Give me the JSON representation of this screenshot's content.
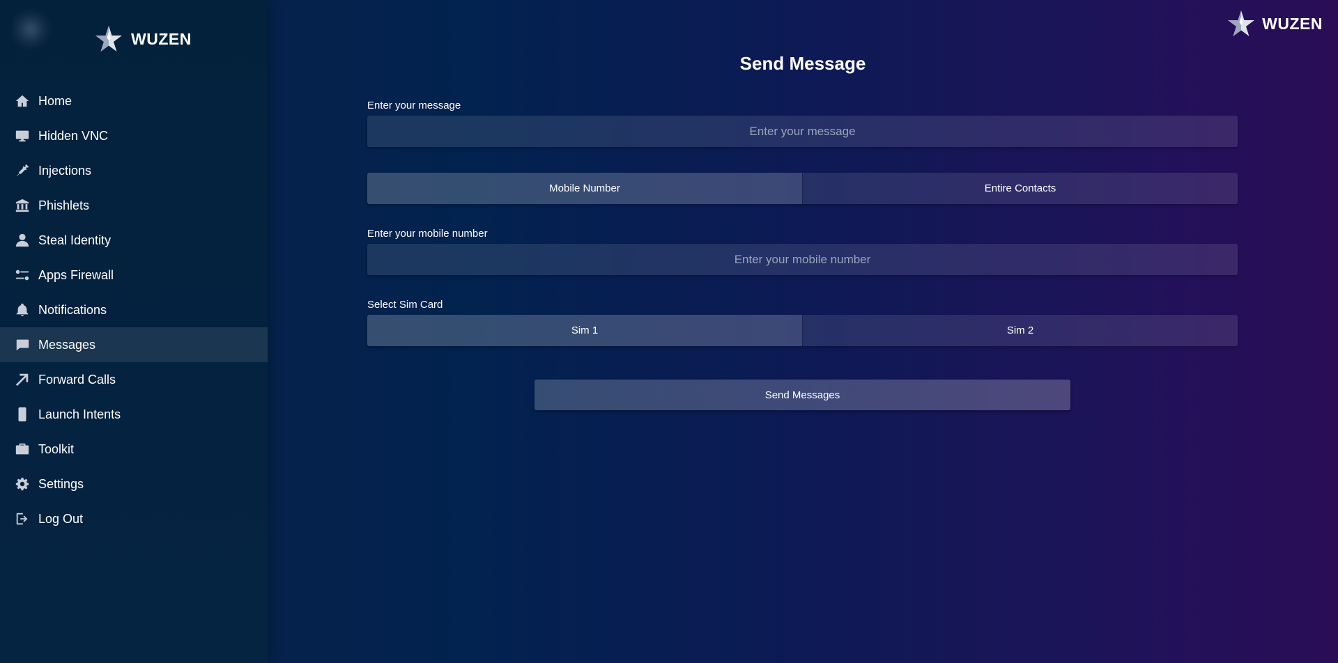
{
  "brand": {
    "name": "WUZEN"
  },
  "sidebar": {
    "items": [
      {
        "label": "Home",
        "icon": "home-icon"
      },
      {
        "label": "Hidden VNC",
        "icon": "monitor-icon"
      },
      {
        "label": "Injections",
        "icon": "syringe-icon"
      },
      {
        "label": "Phishlets",
        "icon": "bank-icon"
      },
      {
        "label": "Steal Identity",
        "icon": "user-icon"
      },
      {
        "label": "Apps Firewall",
        "icon": "toggles-icon"
      },
      {
        "label": "Notifications",
        "icon": "bell-icon"
      },
      {
        "label": "Messages",
        "icon": "chat-icon",
        "active": true
      },
      {
        "label": "Forward Calls",
        "icon": "arrow-up-right-icon"
      },
      {
        "label": "Launch Intents",
        "icon": "phone-icon"
      },
      {
        "label": "Toolkit",
        "icon": "briefcase-icon"
      },
      {
        "label": "Settings",
        "icon": "gear-icon"
      },
      {
        "label": "Log Out",
        "icon": "logout-icon"
      }
    ]
  },
  "main": {
    "title": "Send Message",
    "message": {
      "label": "Enter your message",
      "placeholder": "Enter your message",
      "value": ""
    },
    "recipient_mode": {
      "options": [
        "Mobile Number",
        "Entire Contacts"
      ],
      "selected": "Mobile Number"
    },
    "mobile": {
      "label": "Enter your mobile number",
      "placeholder": "Enter your mobile number",
      "value": ""
    },
    "sim": {
      "label": "Select Sim Card",
      "options": [
        "Sim 1",
        "Sim 2"
      ],
      "selected": "Sim 1"
    },
    "send_label": "Send Messages"
  },
  "colors": {
    "sidebar_bg": "#04213c",
    "main_bg_left": "#02224f",
    "main_bg_right": "#2a0d55",
    "active_item_bg": "#1a3552",
    "icon_fill": "#c9ced8"
  }
}
